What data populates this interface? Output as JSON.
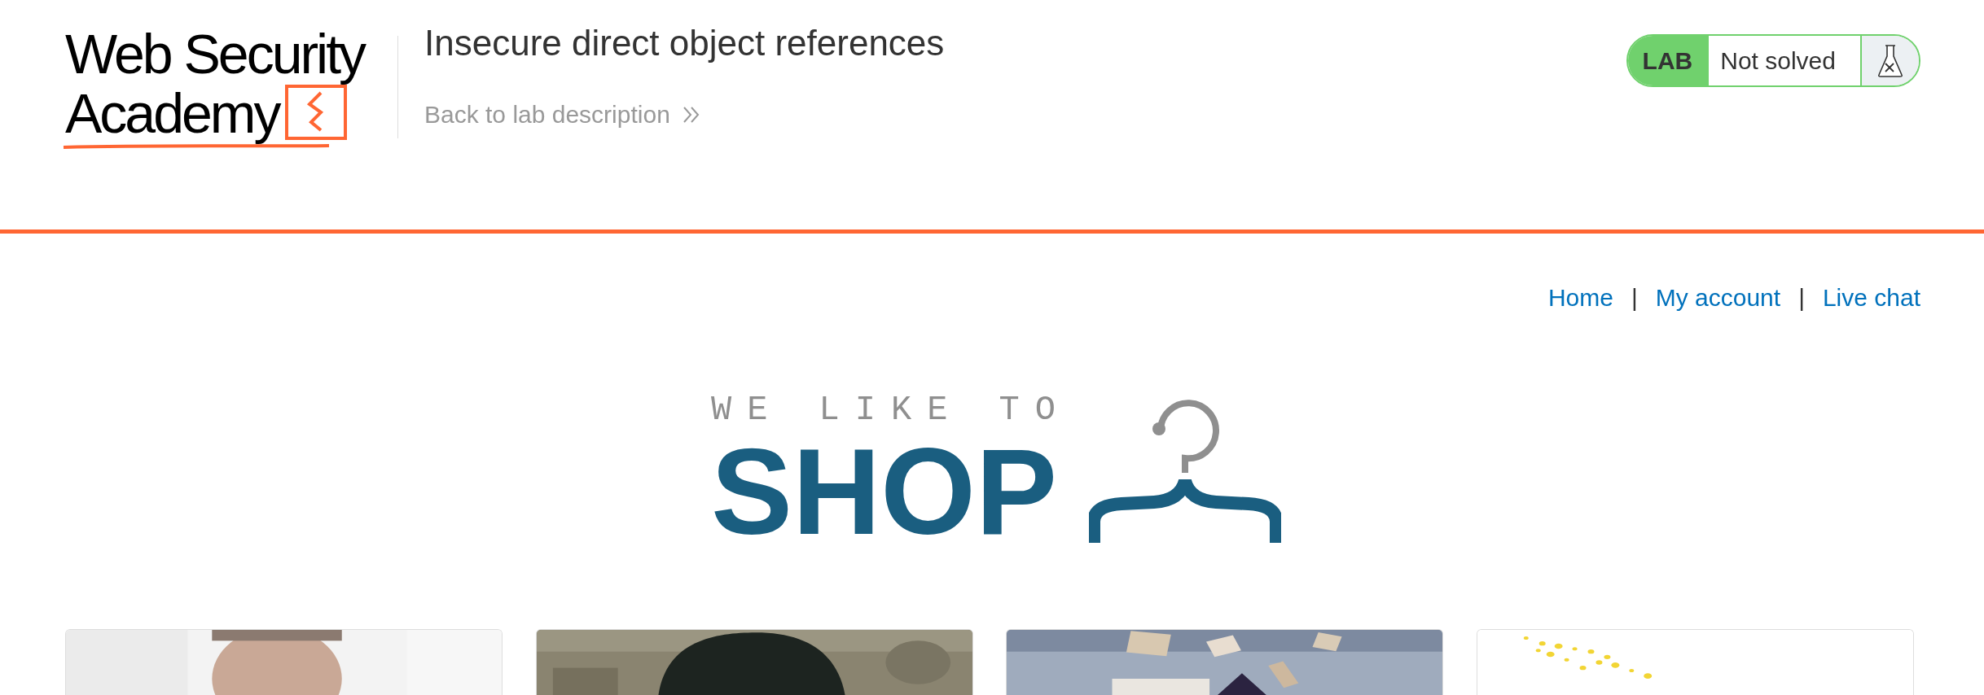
{
  "header": {
    "logo": {
      "line_1": "Web Security",
      "line_2": "Academy"
    },
    "title": "Insecure direct object references",
    "back_link": "Back to lab description",
    "lab_badge": {
      "label": "LAB",
      "status": "Not solved"
    }
  },
  "nav": [
    {
      "kind": "link",
      "text": "Home"
    },
    {
      "kind": "separator",
      "text": "|"
    },
    {
      "kind": "link",
      "text": "My account"
    },
    {
      "kind": "separator",
      "text": "|"
    },
    {
      "kind": "link",
      "text": "Live chat"
    }
  ],
  "shop_logo": {
    "tagline": "WE LIKE TO",
    "word": "SHOP"
  }
}
